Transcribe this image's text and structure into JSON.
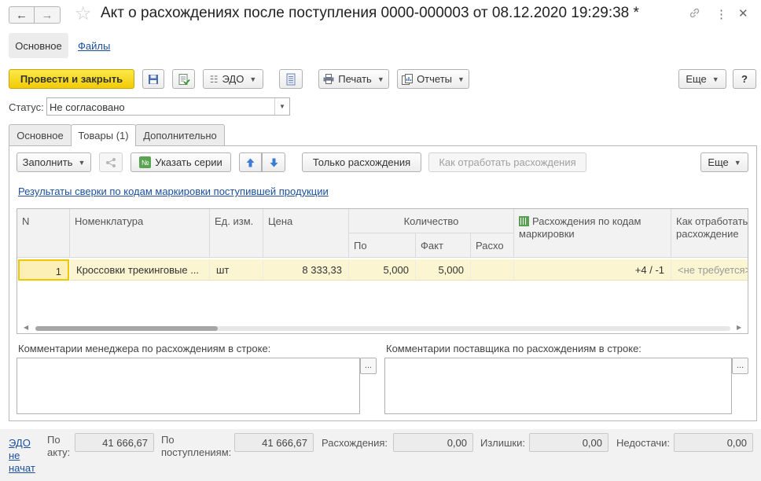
{
  "window": {
    "title": "Акт о расхождениях после поступления 0000-000003 от 08.12.2020 19:29:38 *"
  },
  "section_tabs": {
    "main": "Основное",
    "files": "Файлы"
  },
  "toolbar": {
    "post_close": "Провести и закрыть",
    "edo": "ЭДО",
    "print": "Печать",
    "reports": "Отчеты",
    "more": "Еще",
    "help": "?"
  },
  "status": {
    "label": "Статус:",
    "value": "Не согласовано"
  },
  "tabs": [
    "Основное",
    "Товары (1)",
    "Дополнительно"
  ],
  "goods_toolbar": {
    "fill": "Заполнить",
    "series": "Указать серии",
    "only_disc": "Только расхождения",
    "how_work": "Как отработать расхождения",
    "more": "Еще"
  },
  "marking_link": "Результаты сверки по кодам маркировки поступившей продукции",
  "table": {
    "headers": {
      "n": "N",
      "nom": "Номенклатура",
      "unit": "Ед. изм.",
      "price": "Цена",
      "qty": "Количество",
      "qty_doc": "По",
      "qty_fact": "Факт",
      "qty_disc": "Расхо",
      "marking_1": "Расхождения по кодам",
      "marking_2": "маркировки",
      "action_1": "Как отработать",
      "action_2": "расхождение"
    },
    "rows": [
      {
        "n": "1",
        "nom": "Кроссовки трекинговые ...",
        "unit": "шт",
        "price": "8 333,33",
        "qty_doc": "5,000",
        "qty_fact": "5,000",
        "qty_disc": "",
        "marking": "+4 / -1",
        "action": "<не требуется>"
      }
    ]
  },
  "comments": {
    "manager": "Комментарии менеджера по расхождениям в строке:",
    "supplier": "Комментарии поставщика по расхождениям в строке:",
    "dots": "..."
  },
  "footer": {
    "edo_1": "ЭДО",
    "edo_2": "не",
    "edo_3": "начат",
    "by_act_1": "По",
    "by_act_2": "акту:",
    "by_act_value": "41 666,67",
    "by_receipt_1": "По",
    "by_receipt_2": "поступлениям:",
    "by_receipt_value": "41 666,67",
    "disc_label": "Расхождения:",
    "disc_value": "0,00",
    "surplus_label": "Излишки:",
    "surplus_value": "0,00",
    "shortage_label": "Недостачи:",
    "shortage_value": "0,00"
  },
  "colors": {
    "primary": "#f5d009",
    "link": "#1c4f9c",
    "selected_row": "#fbf5d1"
  }
}
